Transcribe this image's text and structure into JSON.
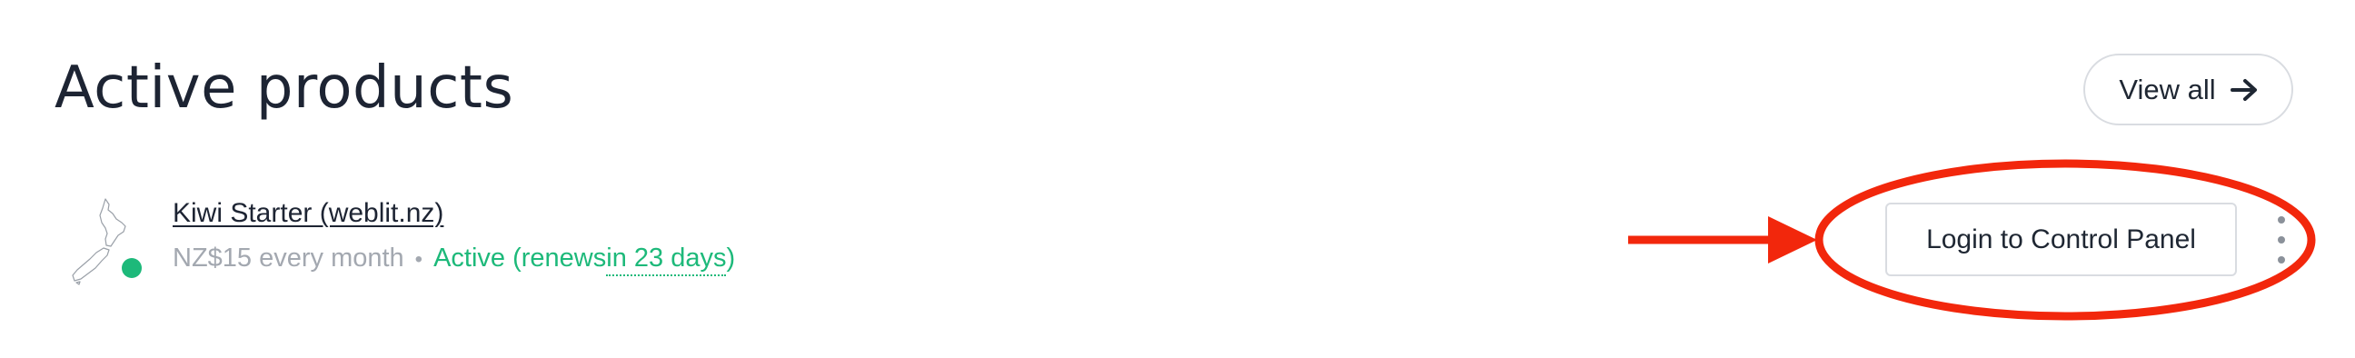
{
  "header": {
    "title": "Active products",
    "view_all_label": "View all"
  },
  "product": {
    "name": "Kiwi Starter (weblit.nz)",
    "price": "NZ$15 every month",
    "separator": "•",
    "status_prefix": "Active (renews ",
    "renews_in": "in 23 days",
    "status_suffix": ")",
    "icon": "new-zealand-map-icon",
    "status_dot_color": "#1db97a"
  },
  "actions": {
    "login_label": "Login to Control Panel",
    "more_icon": "kebab-menu-icon"
  },
  "annotation": {
    "color": "#f2270c",
    "arrow_icon": "arrow-right-icon",
    "highlight": "ellipse"
  }
}
